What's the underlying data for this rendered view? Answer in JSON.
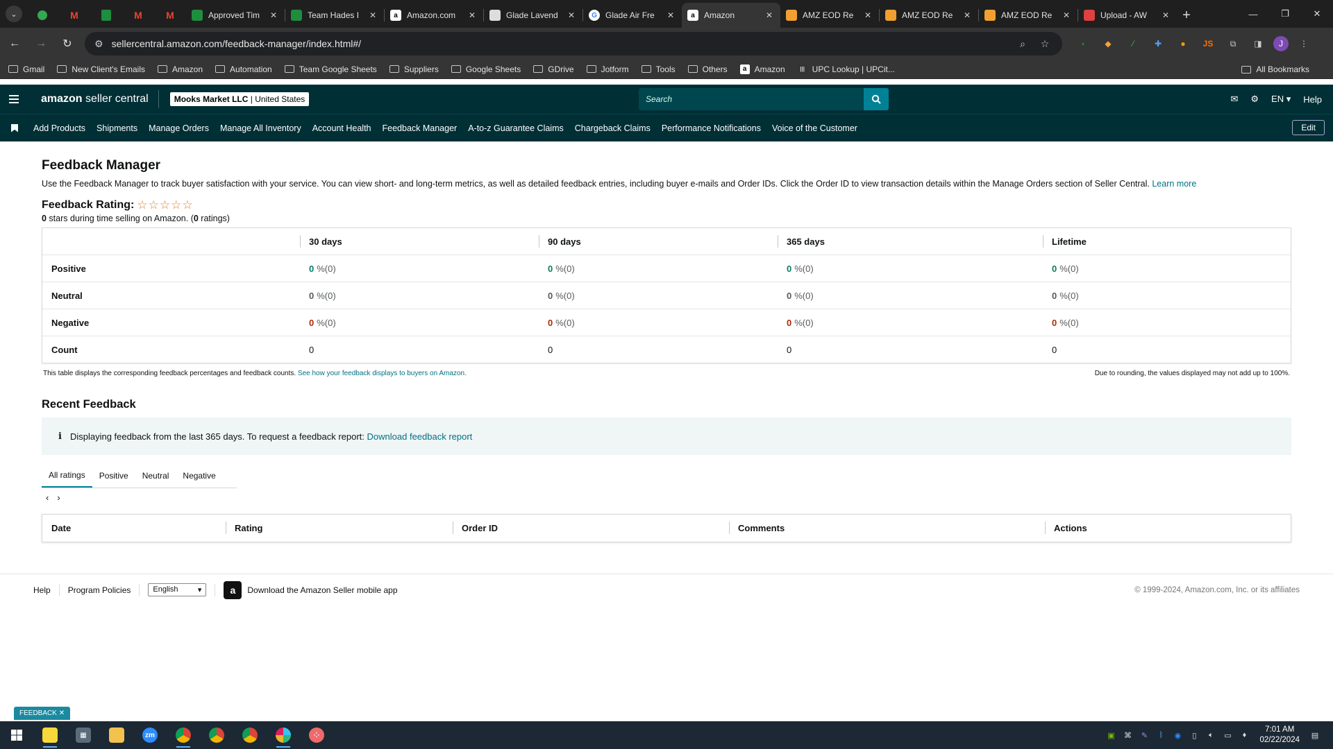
{
  "browser": {
    "tabs": [
      {
        "label": "Approved Tim",
        "icon": "sheets-icon",
        "color": "#1e8e3e"
      },
      {
        "label": "Team Hades I",
        "icon": "sheets-icon",
        "color": "#1e8e3e"
      },
      {
        "label": "Amazon.com",
        "icon": "amazon-icon",
        "color": "#ffffff"
      },
      {
        "label": "Glade Lavend",
        "icon": "page-icon",
        "color": "#dddddd"
      },
      {
        "label": "Glade Air Fre",
        "icon": "google-icon",
        "color": "#ffffff"
      },
      {
        "label": "Amazon",
        "icon": "amazon-icon",
        "color": "#ffffff",
        "active": true
      },
      {
        "label": "AMZ EOD Re",
        "icon": "eod-icon",
        "color": "#f0a030"
      },
      {
        "label": "AMZ EOD Re",
        "icon": "eod-icon",
        "color": "#f0a030"
      },
      {
        "label": "AMZ EOD Re",
        "icon": "eod-icon",
        "color": "#f0a030"
      },
      {
        "label": "Upload - AW",
        "icon": "upload-icon",
        "color": "#e04040"
      }
    ],
    "url": "sellercentral.amazon.com/feedback-manager/index.html#/",
    "avatar_letter": "J",
    "bookmarks": [
      {
        "label": "Gmail",
        "type": "folder"
      },
      {
        "label": "New Client's Emails",
        "type": "folder"
      },
      {
        "label": "Amazon",
        "type": "folder"
      },
      {
        "label": "Automation",
        "type": "folder"
      },
      {
        "label": "Team Google Sheets",
        "type": "folder"
      },
      {
        "label": "Suppliers",
        "type": "folder"
      },
      {
        "label": "Google Sheets",
        "type": "folder"
      },
      {
        "label": "GDrive",
        "type": "folder"
      },
      {
        "label": "Jotform",
        "type": "folder"
      },
      {
        "label": "Tools",
        "type": "folder"
      },
      {
        "label": "Others",
        "type": "folder"
      },
      {
        "label": "Amazon",
        "type": "amazon"
      },
      {
        "label": "UPC Lookup | UPCit...",
        "type": "upc"
      }
    ],
    "all_bookmarks": "All Bookmarks"
  },
  "header": {
    "logo_bold": "amazon",
    "logo_rest": " seller central",
    "store_name": "Mooks Market LLC",
    "store_region": "United States",
    "search_placeholder": "Search",
    "lang": "EN",
    "help": "Help"
  },
  "nav": {
    "items": [
      "Add Products",
      "Shipments",
      "Manage Orders",
      "Manage All Inventory",
      "Account Health",
      "Feedback Manager",
      "A-to-z Guarantee Claims",
      "Chargeback Claims",
      "Performance Notifications",
      "Voice of the Customer"
    ],
    "edit": "Edit"
  },
  "page": {
    "title": "Feedback Manager",
    "description": "Use the Feedback Manager to track buyer satisfaction with your service. You can view short- and long-term metrics, as well as detailed feedback entries, including buyer e-mails and Order IDs. Click the Order ID to view transaction details within the Manage Orders section of Seller Central.",
    "learn_more": "Learn more",
    "rating_label": "Feedback Rating:",
    "stars": "☆☆☆☆☆",
    "rating_count_stars": "0",
    "rating_mid": " stars during time selling on Amazon. (",
    "rating_count": "0",
    "rating_end": " ratings)"
  },
  "feedback_table": {
    "columns": [
      "30 days",
      "90 days",
      "365 days",
      "Lifetime"
    ],
    "rows": [
      {
        "label": "Positive",
        "kind": "positive",
        "values": [
          "0",
          "0",
          "0",
          "0"
        ],
        "suffix": "%(0)"
      },
      {
        "label": "Neutral",
        "kind": "neutral",
        "values": [
          "0",
          "0",
          "0",
          "0"
        ],
        "suffix": "%(0)"
      },
      {
        "label": "Negative",
        "kind": "negative",
        "values": [
          "0",
          "0",
          "0",
          "0"
        ],
        "suffix": "%(0)"
      },
      {
        "label": "Count",
        "kind": "count",
        "values": [
          "0",
          "0",
          "0",
          "0"
        ],
        "suffix": ""
      }
    ],
    "note_left": "This table displays the corresponding feedback percentages and feedback counts.",
    "note_link": "See how your feedback displays to buyers on Amazon.",
    "note_right": "Due to rounding, the values displayed may not add up to 100%."
  },
  "recent": {
    "title": "Recent Feedback",
    "info_icon": "i",
    "info_text": "Displaying feedback from the last 365 days. To request a feedback report:",
    "info_link": "Download feedback report",
    "tabs": [
      "All ratings",
      "Positive",
      "Neutral",
      "Negative"
    ],
    "active_tab": 0,
    "columns": [
      "Date",
      "Rating",
      "Order ID",
      "Comments",
      "Actions"
    ]
  },
  "footer": {
    "help": "Help",
    "policies": "Program Policies",
    "language": "English",
    "app_text": "Download the Amazon Seller mobile app",
    "copyright": "© 1999-2024, Amazon.com, Inc. or its affiliates"
  },
  "feedback_tab": "FEEDBACK",
  "taskbar": {
    "time": "7:01 AM",
    "date": "02/22/2024"
  }
}
